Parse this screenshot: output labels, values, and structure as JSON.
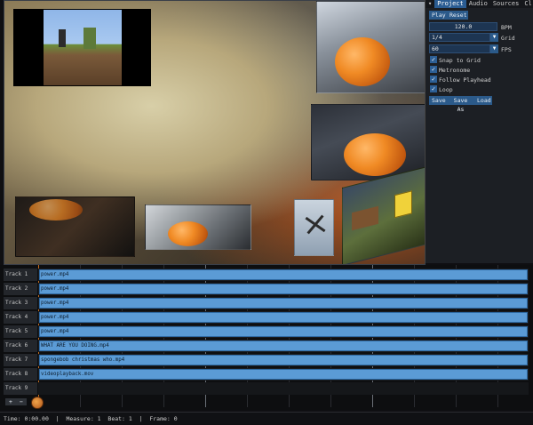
{
  "panel": {
    "tabs": [
      "Project",
      "Audio",
      "Sources",
      "Cl"
    ],
    "play_label": "Play",
    "reset_label": "Reset",
    "bpm_value": "120.0",
    "bpm_label": "BPM",
    "grid_value": "1/4",
    "grid_label": "Grid",
    "fps_value": "60",
    "fps_label": "FPS",
    "options": [
      {
        "label": "Snap to Grid",
        "checked": true
      },
      {
        "label": "Metronome",
        "checked": true
      },
      {
        "label": "Follow Playhead",
        "checked": true
      },
      {
        "label": "Loop",
        "checked": true
      }
    ],
    "save_label": "Save",
    "save_as_label": "Save As",
    "load_label": "Load"
  },
  "timeline": {
    "tracks": [
      {
        "name": "Track 1",
        "clip": "power.mp4"
      },
      {
        "name": "Track 2",
        "clip": "power.mp4"
      },
      {
        "name": "Track 3",
        "clip": "power.mp4"
      },
      {
        "name": "Track 4",
        "clip": "power.mp4"
      },
      {
        "name": "Track 5",
        "clip": "power.mp4"
      },
      {
        "name": "Track 6",
        "clip": "WHAT ARE YOU DOING.mp4"
      },
      {
        "name": "Track 7",
        "clip": "spongebob christmas who.mp4"
      },
      {
        "name": "Track 8",
        "clip": "videoplayback.mov"
      },
      {
        "name": "Track 9",
        "clip": ""
      }
    ],
    "add_label": "+",
    "remove_label": "−"
  },
  "status": {
    "text": "Time: 0:00.00  |  Measure: 1  Beat: 1  |  Frame: 0"
  },
  "colors": {
    "accent": "#2b5a8a",
    "clip": "#5b9bd5"
  }
}
